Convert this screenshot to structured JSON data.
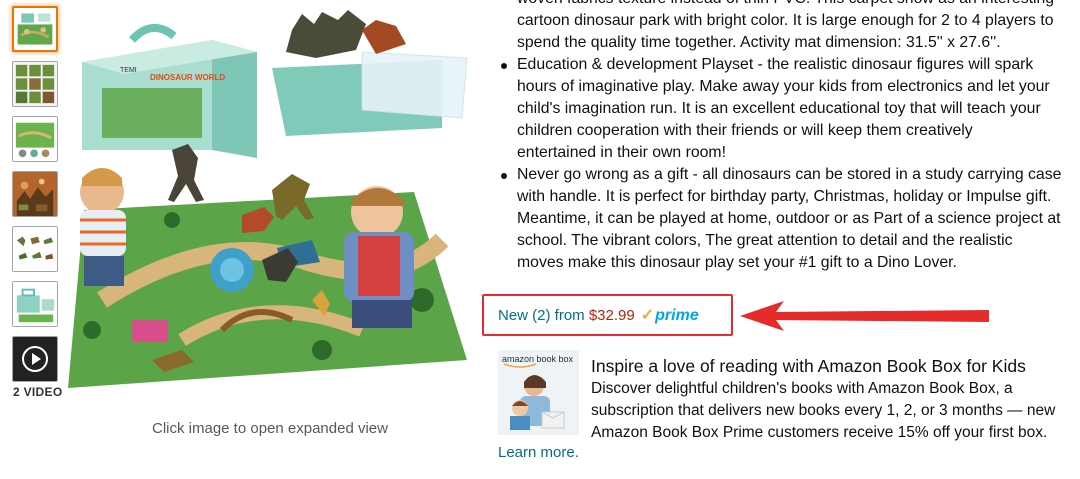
{
  "thumbnails": {
    "items": [
      {
        "name": "thumb-playset-mat"
      },
      {
        "name": "thumb-dinosaur-grid"
      },
      {
        "name": "thumb-mat-detail"
      },
      {
        "name": "thumb-dinosaur-collection"
      },
      {
        "name": "thumb-dinosaur-lineup"
      },
      {
        "name": "thumb-carry-case"
      }
    ],
    "video_label": "2 VIDEO"
  },
  "main_image": {
    "caption": "Click image to open expanded view",
    "box_brand": "TEMI",
    "box_title": "DINOSAUR WORLD"
  },
  "bullets": {
    "top_continuation": [
      "woven fabrics texture instead of thin PVC. This carpet show as an interesting",
      "cartoon dinosaur park with bright color. It is large enough for 2 to 4 players to",
      "spend the quality time together. Activity mat dimension: 31.5'' x 27.6''."
    ],
    "items": [
      {
        "lines": [
          "Education & development Playset - the realistic dinosaur figures will spark",
          "hours of imaginative play. Make away your kids from electronics and let your",
          "child's imagination run. It is an excellent educational toy that will teach your",
          "children cooperation with their friends or will keep them creatively",
          "entertained in their own room!"
        ]
      },
      {
        "lines": [
          "Never go wrong as a gift - all dinosaurs can be stored in a study carrying case",
          "with handle. It is perfect for birthday party, Christmas, holiday or Impulse gift.",
          "Meantime, it can be played at home, outdoor or as Part of a science project at",
          "school. The vibrant colors, The great attention to detail and the realistic",
          "moves make this dinosaur play set your #1 gift to a Dino Lover."
        ]
      }
    ]
  },
  "offer": {
    "new_label": "New (2) from ",
    "price": "$32.99",
    "prime_check": "✓",
    "prime_label": "prime"
  },
  "bookbox": {
    "logo_text": "amazon book box",
    "title": "Inspire a love of reading with Amazon Book Box for Kids",
    "body_lines": [
      "Discover delightful children's books with Amazon Book Box, a",
      "subscription that delivers new books every 1, 2, or 3 months — new",
      "Amazon Book Box Prime customers receive 15% off your first box."
    ],
    "learn_more": "Learn more."
  },
  "colors": {
    "link": "#007185",
    "price": "#b12704",
    "annotation_red": "#e52b2b",
    "prime_blue": "#00a8e1",
    "prime_check": "#f3a847",
    "thumb_active": "#e77600"
  }
}
